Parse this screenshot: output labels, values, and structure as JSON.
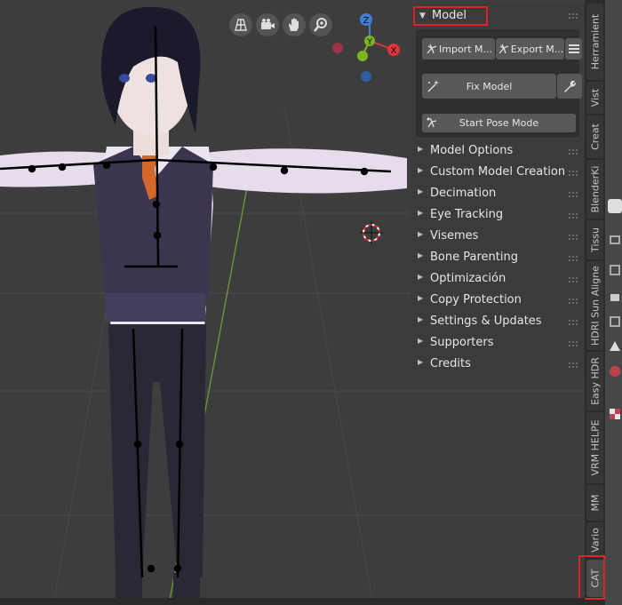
{
  "viewport": {
    "tools": [
      {
        "name": "grid-view-icon",
        "label": ""
      },
      {
        "name": "camera-icon",
        "label": ""
      },
      {
        "name": "hand-pan-icon",
        "label": ""
      },
      {
        "name": "zoom-icon",
        "label": ""
      }
    ],
    "gizmo": {
      "z": "Z",
      "y": "Y",
      "x": "X"
    }
  },
  "panel": {
    "header": "Model",
    "buttons": {
      "import": "Import M...",
      "export": "Export M...",
      "fix": "Fix Model",
      "pose": "Start Pose Mode"
    },
    "sections": [
      "Model Options",
      "Custom Model Creation",
      "Decimation",
      "Eye Tracking",
      "Visemes",
      "Bone Parenting",
      "Optimización",
      "Copy Protection",
      "Settings & Updates",
      "Supporters",
      "Credits"
    ]
  },
  "tabs": [
    "Herramient",
    "Vist",
    "Creat",
    "BlenderKi",
    "Tissu",
    "HDRI Sun Aligne",
    "Easy HDR",
    "VRM HELPE",
    "MM",
    "Vario",
    "CAT"
  ],
  "colors": {
    "highlight": "#e0202a",
    "button": "#585858",
    "panel": "#3b3b3b"
  }
}
